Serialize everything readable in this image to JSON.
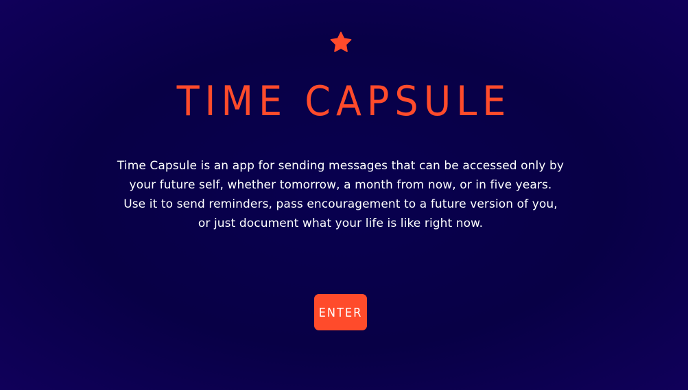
{
  "app": {
    "title": "TIME CAPSULE",
    "description": "Time Capsule is an app for sending messages that can be accessed only by your future self, whether tomorrow, a month from now, or in five years. Use it to send reminders, pass encouragement to a future version of you, or just document what your life is like right now.",
    "icon": "star-icon",
    "enter_label": "ENTER"
  },
  "colors": {
    "background": "#080046",
    "accent": "#ff4b2b",
    "text": "#ffffff"
  }
}
